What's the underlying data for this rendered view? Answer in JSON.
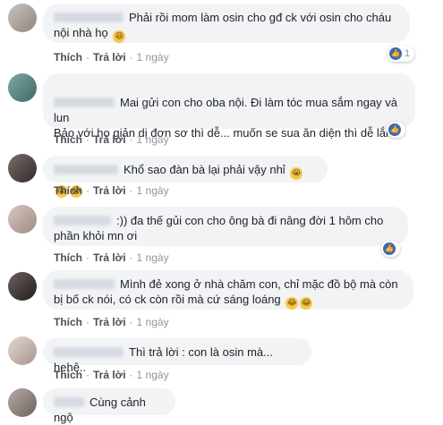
{
  "actions": {
    "like": "Thích",
    "reply": "Trả lời",
    "sep": "·",
    "time": "1 ngày"
  },
  "comments": [
    {
      "text": "Phải rồi mom làm osin cho gđ ck với osin cho cháu nội nhà họ",
      "likes": "1"
    },
    {
      "text": "Mai gửi con cho oba nội. Đi làm tóc mua sắm ngay và lun\nBảo với họ giản dị đơn sơ thì dễ... muốn se sua ăn diện thì dễ lắm",
      "likes": ""
    },
    {
      "text": "Khổ  sao đàn bà lại phải vậy nhỉ",
      "likes": ""
    },
    {
      "text": ":)) đa thế gủi con cho ông bà đi nâng đời 1 hôm cho phần khỏi mn ơi",
      "likes": ""
    },
    {
      "text": "Mình đẻ xong ở nhà chăm con, chỉ mặc đồ bộ mà còn bị bố ck nói, có ck còn rồi mà cứ sáng loáng",
      "likes": ""
    },
    {
      "text": "Thì trả lời : con là osin mà... hehê..",
      "likes": ""
    },
    {
      "text": "Cùng cảnh ngộ",
      "likes": ""
    }
  ],
  "icons": {
    "like": "like-icon",
    "emoji_laugh": "laughing-emoji-icon",
    "emoji_cry": "crying-emoji-icon"
  },
  "colors": {
    "bubble": "#f2f3f5",
    "like_blue": "#4267b2",
    "meta": "#90949c"
  }
}
